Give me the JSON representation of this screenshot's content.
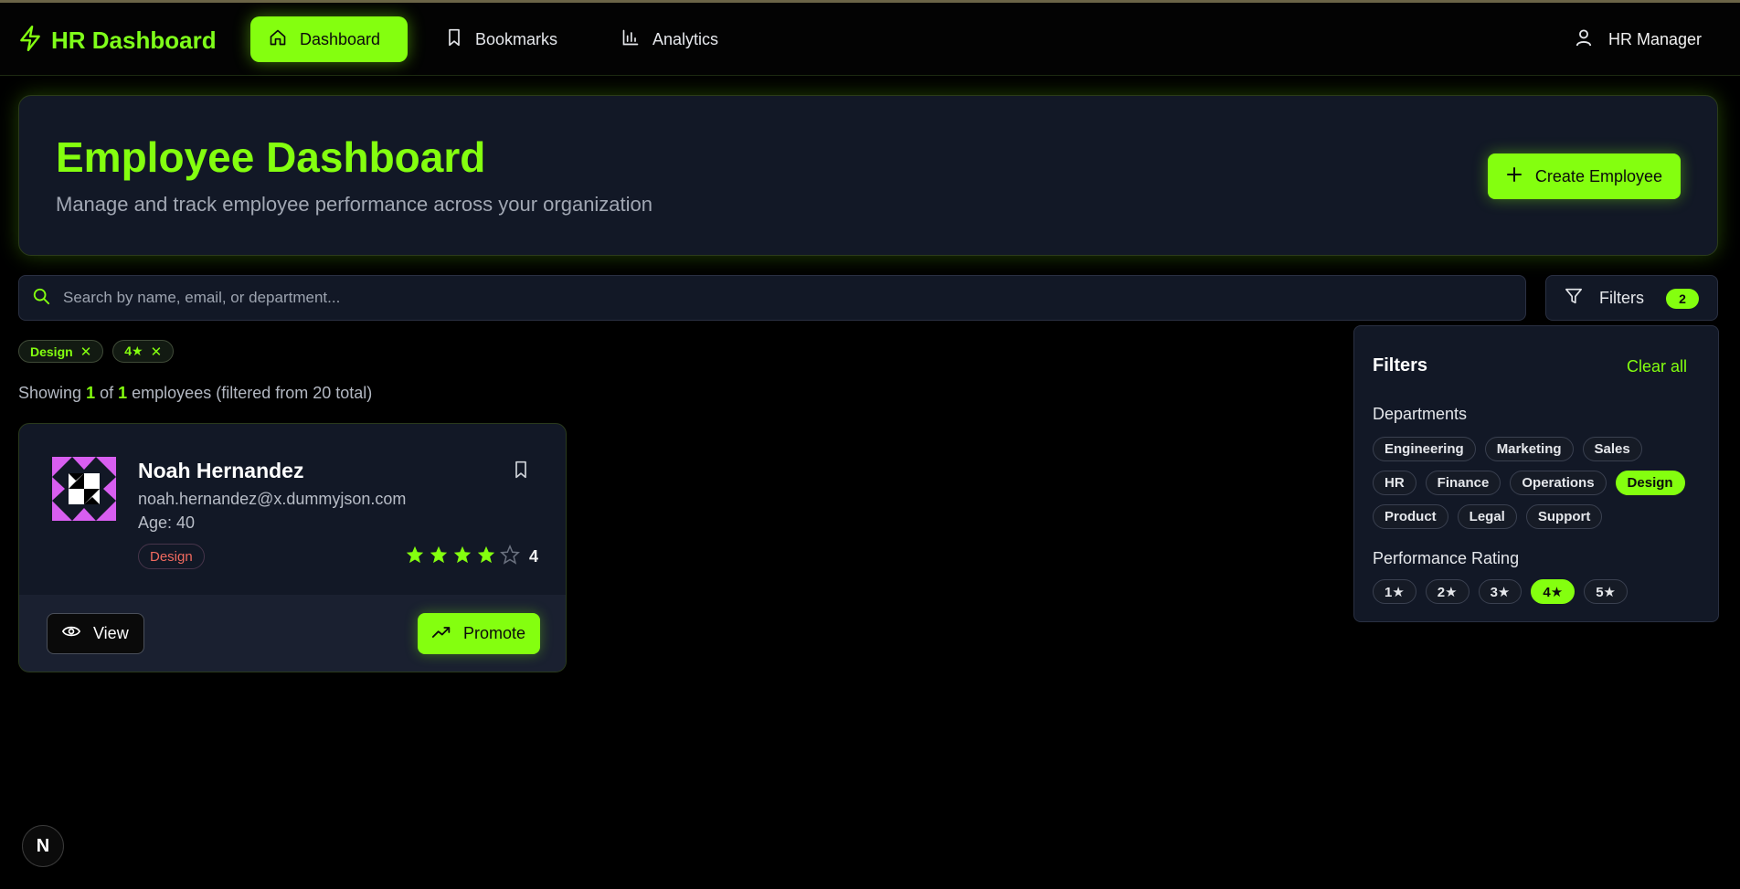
{
  "nav": {
    "brand": "HR Dashboard",
    "items": [
      {
        "label": "Dashboard",
        "icon": "home-icon",
        "active": true
      },
      {
        "label": "Bookmarks",
        "icon": "bookmark-icon",
        "active": false
      },
      {
        "label": "Analytics",
        "icon": "bar-chart-icon",
        "active": false
      }
    ],
    "user": "HR Manager"
  },
  "hero": {
    "title": "Employee Dashboard",
    "subtitle": "Manage and track employee performance across your organization",
    "create_label": "Create Employee"
  },
  "search": {
    "placeholder": "Search by name, email, or department...",
    "value": ""
  },
  "filters_button": {
    "label": "Filters",
    "count": "2"
  },
  "active_chips": [
    {
      "label": "Design",
      "remove": "✕"
    },
    {
      "label": "4★",
      "remove": "✕"
    }
  ],
  "summary": {
    "prefix": "Showing",
    "shown": "1",
    "of": "of",
    "total_shown": "1",
    "suffix": "employees (filtered from 20 total)"
  },
  "employee": {
    "name": "Noah Hernandez",
    "email": "noah.hernandez@x.dummyjson.com",
    "age": "Age: 40",
    "department": "Design",
    "rating": 4,
    "rating_label": "4",
    "view_label": "View",
    "promote_label": "Promote"
  },
  "filter_panel": {
    "title": "Filters",
    "clear_label": "Clear all",
    "departments_label": "Departments",
    "departments": [
      {
        "label": "Engineering",
        "on": false
      },
      {
        "label": "Marketing",
        "on": false
      },
      {
        "label": "Sales",
        "on": false
      },
      {
        "label": "HR",
        "on": false
      },
      {
        "label": "Finance",
        "on": false
      },
      {
        "label": "Operations",
        "on": false
      },
      {
        "label": "Design",
        "on": true
      },
      {
        "label": "Product",
        "on": false
      },
      {
        "label": "Legal",
        "on": false
      },
      {
        "label": "Support",
        "on": false
      }
    ],
    "rating_label": "Performance Rating",
    "ratings": [
      {
        "label": "1★",
        "on": false
      },
      {
        "label": "2★",
        "on": false
      },
      {
        "label": "3★",
        "on": false
      },
      {
        "label": "4★",
        "on": true
      },
      {
        "label": "5★",
        "on": false
      }
    ]
  },
  "dev_badge": "N",
  "colors": {
    "accent": "#84ff0f",
    "panel": "#121826",
    "department_text": "#f06a5f"
  }
}
